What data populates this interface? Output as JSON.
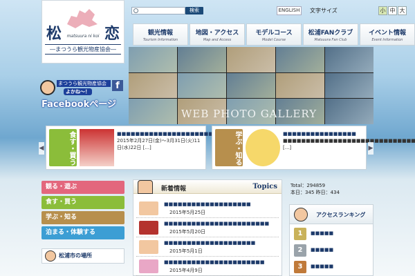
{
  "header": {
    "logo_kanji_left": "松",
    "logo_kanji_right": "恋",
    "logo_roman": "matsuura ni koi",
    "logo_assoc": "―まつうら観光物産協会―",
    "search_button": "検索",
    "english_button": "ENGLISH",
    "font_size_label": "文字サイズ",
    "font_sizes": [
      "小",
      "中",
      "大"
    ],
    "nav": [
      {
        "jp": "観光情報",
        "en": "Tourism Information"
      },
      {
        "jp": "地図・アクセス",
        "en": "Map and Access"
      },
      {
        "jp": "モデルコース",
        "en": "Model Course"
      },
      {
        "jp": "松浦FANクラブ",
        "en": "Matsuura Fan Club"
      },
      {
        "jp": "イベント情報",
        "en": "Event Information"
      }
    ]
  },
  "facebook": {
    "badge": "まつうら観光物産協会",
    "speech": "よかね～！",
    "f_letter": "f",
    "label": "Facebookページ"
  },
  "gallery": {
    "title": "WEB PHOTO GALLERY"
  },
  "features": [
    {
      "category": "食す・買う",
      "link": "■■■■■■■■■■■■■■■■■■■■■",
      "body": "2015年2月27日(金)〜3月31日(火)11日(水)22日 [...]"
    },
    {
      "category": "学ぶ・知る",
      "link": "■■■■■■■■■■■■■■■■",
      "body": "■■■■■■■■■■■■■■■■■■■■■■■■■■■■■■■■ [...]"
    }
  ],
  "left_nav": [
    {
      "label": "観る・遊ぶ",
      "color": "#e3677d"
    },
    {
      "label": "食す・買う",
      "color": "#8bbd3a"
    },
    {
      "label": "学ぶ・知る",
      "color": "#b78f4d"
    },
    {
      "label": "泊まる・体験する",
      "color": "#3c9ed4"
    }
  ],
  "location": "松浦市の場所",
  "news": {
    "title_jp": "新着情報",
    "title_en": "Topics",
    "items": [
      {
        "title": "■■■■■■■■■■■■■■■■■■■",
        "date": "2015年5月25日"
      },
      {
        "title": "■■■■■■■■■■■■■■■■■■■■■■■",
        "date": "2015年5月20日"
      },
      {
        "title": "■■■■■■■■■■■■■■■■■■■■",
        "date": "2015年5月1日"
      },
      {
        "title": "■■■■■■■■■■■■■■■■■■■■■■",
        "date": "2015年4月9日"
      }
    ]
  },
  "counter": {
    "total": "Total：294859",
    "today": "本日：345 昨日：434"
  },
  "ranking": {
    "title": "アクセスランキング",
    "items": [
      {
        "num": "1",
        "label": "■■■■■",
        "color": "#c9b25a"
      },
      {
        "num": "2",
        "label": "■■■■■",
        "color": "#9aa3aa"
      },
      {
        "num": "3",
        "label": "■■■■■",
        "color": "#c07a3a"
      }
    ]
  }
}
